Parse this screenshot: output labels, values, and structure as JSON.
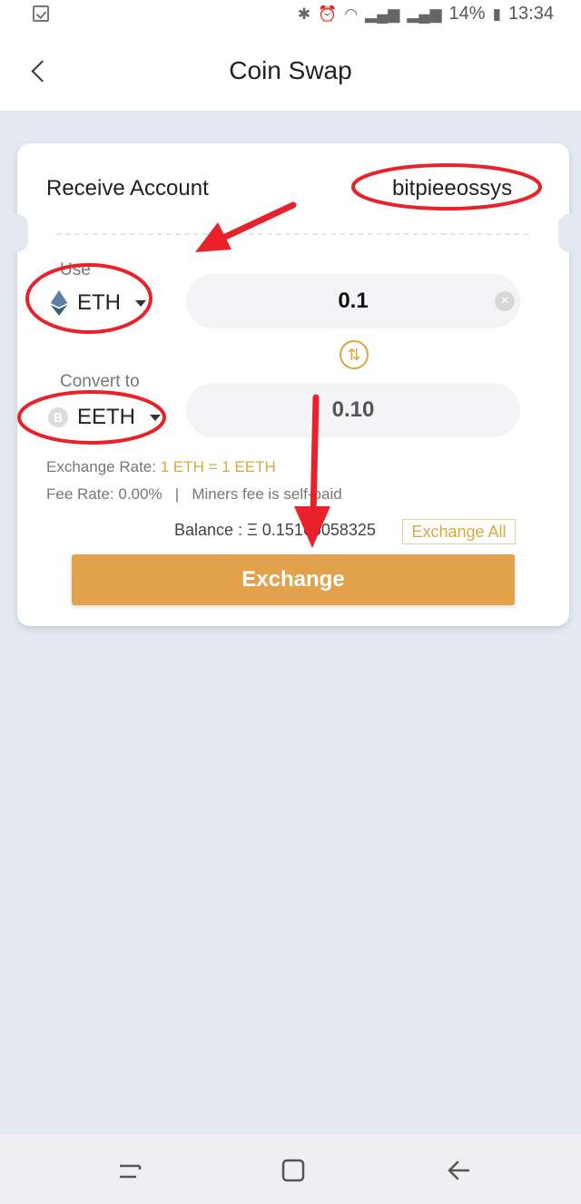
{
  "status_bar": {
    "battery": "14%",
    "time": "13:34"
  },
  "header": {
    "title": "Coin Swap"
  },
  "receive": {
    "label": "Receive Account",
    "value": "bitpieeossys"
  },
  "use": {
    "label": "Use",
    "coin": "ETH",
    "amount": "0.1"
  },
  "convert": {
    "label": "Convert to",
    "coin": "EETH",
    "amount": "0.10"
  },
  "rates": {
    "exchange_label": "Exchange Rate:",
    "exchange_value": "1 ETH = 1 EETH",
    "fee_line": "Fee Rate: 0.00%   |   Miners fee is self-paid"
  },
  "balance": {
    "label": "Balance :",
    "symbol": "Ξ",
    "value": "0.15166058325"
  },
  "buttons": {
    "exchange_all": "Exchange All",
    "exchange": "Exchange"
  },
  "colors": {
    "accent_gold": "#d9a83f",
    "exchange_button": "#e2a24b",
    "annotation_red": "#e8212a",
    "background": "#e4e8f0"
  }
}
